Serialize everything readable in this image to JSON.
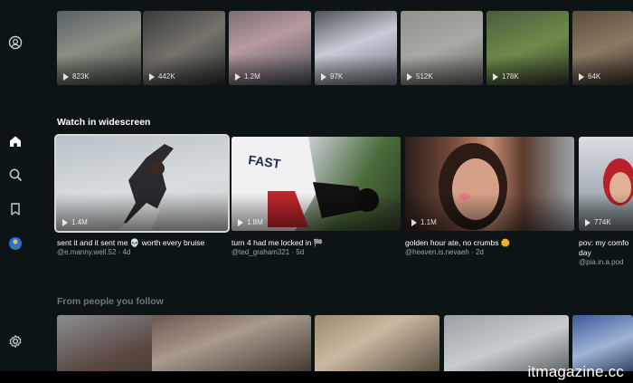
{
  "sidebar": {
    "icons": [
      "account-circle-icon",
      "home-icon",
      "search-icon",
      "bookmark-icon",
      "avatar",
      "settings-icon"
    ]
  },
  "top_row": {
    "views": [
      "823K",
      "442K",
      "1.2M",
      "97K",
      "512K",
      "178K",
      "64K"
    ]
  },
  "widescreen": {
    "title": "Watch in widescreen",
    "cards": [
      {
        "views": "1.4M",
        "caption": "sent it and it sent me 💀 worth every bruise",
        "meta": "@e.manny.well.52 · 4d"
      },
      {
        "views": "1.8M",
        "caption": "turn 4 had me locked in 🏁",
        "meta": "@ted_graham321 · 5d"
      },
      {
        "views": "1.1M",
        "caption": "golden hour ate, no crumbs 🌼",
        "meta": "@heaven.is.nevaeh · 2d"
      },
      {
        "views": "774K",
        "caption": "pov: my comfo day",
        "meta": "@pia.in.a.pod"
      }
    ]
  },
  "following": {
    "title": "From people you follow"
  },
  "watermark": "itmagazine.cc"
}
